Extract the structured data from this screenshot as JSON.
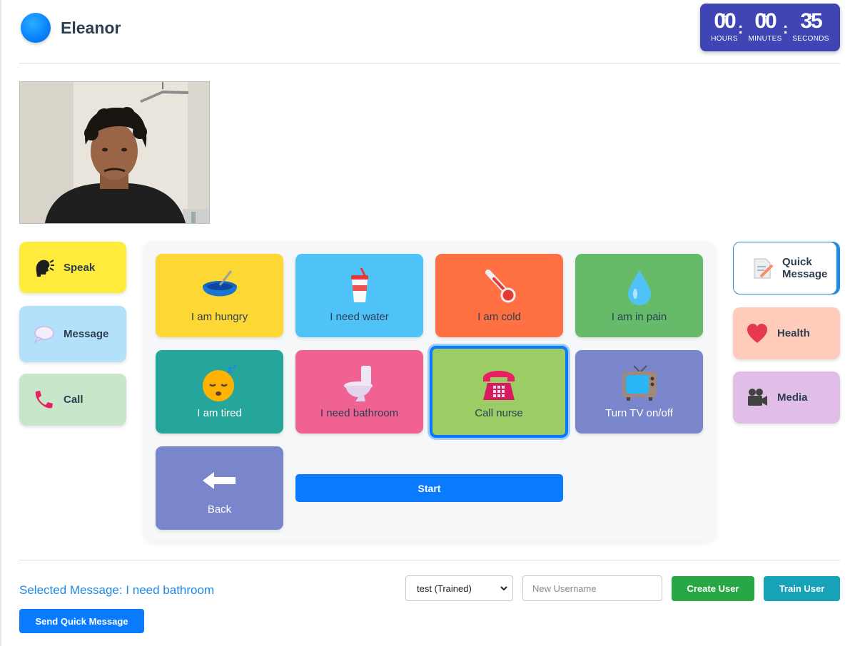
{
  "user": {
    "name": "Eleanor"
  },
  "timer": {
    "hours": "00",
    "minutes": "00",
    "seconds": "35",
    "hours_label": "HOURS",
    "minutes_label": "MINUTES",
    "seconds_label": "SECONDS"
  },
  "left_menu": [
    {
      "label": "Speak",
      "icon": "speaking-head-icon",
      "color": "#ffeb3b"
    },
    {
      "label": "Message",
      "icon": "speech-balloon-icon",
      "color": "#b3e0fb"
    },
    {
      "label": "Call",
      "icon": "telephone-receiver-icon",
      "color": "#c8e6c9"
    }
  ],
  "right_menu": [
    {
      "label": "Quick\nMessage",
      "icon": "memo-icon",
      "color": "#ffffff",
      "active": true
    },
    {
      "label": "Health",
      "icon": "heart-icon",
      "color": "#ffccbc"
    },
    {
      "label": "Media",
      "icon": "movie-camera-icon",
      "color": "#e1bee7"
    }
  ],
  "tiles": [
    {
      "label": "I am hungry",
      "icon": "bowl-icon",
      "color": "#fdd835",
      "text_color": "#2c3e50"
    },
    {
      "label": "I need water",
      "icon": "cup-with-straw-icon",
      "color": "#4fc3f7",
      "text_color": "#2c3e50"
    },
    {
      "label": "I am cold",
      "icon": "thermometer-icon",
      "color": "#ff7043",
      "text_color": "#2c3e50"
    },
    {
      "label": "I am in pain",
      "icon": "droplet-icon",
      "color": "#66bb6a",
      "text_color": "#2c3e50"
    },
    {
      "label": "I am tired",
      "icon": "sleeping-face-icon",
      "color": "#26a69a",
      "text_color": "#ffffff"
    },
    {
      "label": "I need bathroom",
      "icon": "toilet-icon",
      "color": "#f06292",
      "text_color": "#2c3e50"
    },
    {
      "label": "Call nurse",
      "icon": "telephone-icon",
      "color": "#9ccc65",
      "text_color": "#2c3e50",
      "selected": true
    },
    {
      "label": "Turn TV on/off",
      "icon": "television-icon",
      "color": "#7986cb",
      "text_color": "#ffffff"
    },
    {
      "label": "Back",
      "icon": "left-arrow-icon",
      "color": "#7986cb",
      "text_color": "#ffffff"
    }
  ],
  "start_button": "Start",
  "selected_message": "Selected Message: I need bathroom",
  "send_button": "Send Quick Message",
  "user_select": {
    "value": "test (Trained)"
  },
  "new_username": {
    "placeholder": "New Username",
    "value": ""
  },
  "create_user_button": {
    "label": "Create User",
    "color": "#28a745"
  },
  "train_user_button": {
    "label": "Train User",
    "color": "#17a2b8"
  }
}
